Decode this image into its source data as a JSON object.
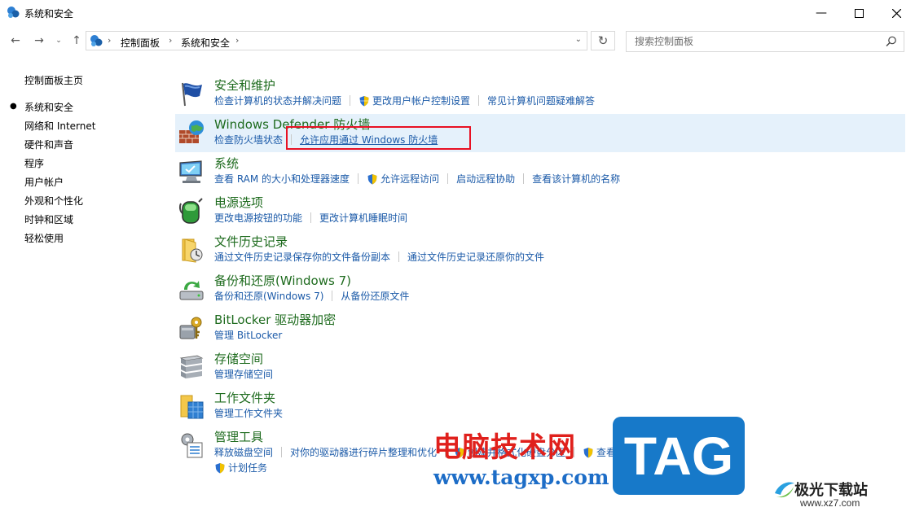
{
  "window": {
    "title": "系统和安全"
  },
  "address": {
    "crumbs": [
      "控制面板",
      "系统和安全"
    ]
  },
  "search": {
    "placeholder": "搜索控制面板"
  },
  "sidebar": {
    "home": "控制面板主页",
    "items": [
      {
        "label": "系统和安全",
        "active": true
      },
      {
        "label": "网络和 Internet"
      },
      {
        "label": "硬件和声音"
      },
      {
        "label": "程序"
      },
      {
        "label": "用户帐户"
      },
      {
        "label": "外观和个性化"
      },
      {
        "label": "时钟和区域"
      },
      {
        "label": "轻松使用"
      }
    ]
  },
  "categories": [
    {
      "title": "安全和维护",
      "icon": "flag-icon",
      "links": [
        "检查计算机的状态并解决问题",
        "更改用户帐户控制设置",
        "常见计算机问题疑难解答"
      ]
    },
    {
      "title": "Windows Defender 防火墙",
      "icon": "firewall-icon",
      "links": [
        "检查防火墙状态",
        "允许应用通过 Windows 防火墙"
      ]
    },
    {
      "title": "系统",
      "icon": "computer-icon",
      "links": [
        "查看 RAM 的大小和处理器速度",
        "允许远程访问",
        "启动远程协助",
        "查看该计算机的名称"
      ]
    },
    {
      "title": "电源选项",
      "icon": "battery-icon",
      "links": [
        "更改电源按钮的功能",
        "更改计算机睡眠时间"
      ]
    },
    {
      "title": "文件历史记录",
      "icon": "folder-clock-icon",
      "links": [
        "通过文件历史记录保存你的文件备份副本",
        "通过文件历史记录还原你的文件"
      ]
    },
    {
      "title": "备份和还原(Windows 7)",
      "icon": "backup-icon",
      "links": [
        "备份和还原(Windows 7)",
        "从备份还原文件"
      ]
    },
    {
      "title": "BitLocker 驱动器加密",
      "icon": "bitlocker-key-icon",
      "links": [
        "管理 BitLocker"
      ]
    },
    {
      "title": "存储空间",
      "icon": "storage-icon",
      "links": [
        "管理存储空间"
      ]
    },
    {
      "title": "工作文件夹",
      "icon": "work-folders-icon",
      "links": [
        "管理工作文件夹"
      ]
    },
    {
      "title": "管理工具",
      "icon": "admin-tools-icon",
      "links": [
        "释放磁盘空间",
        "对你的驱动器进行碎片整理和优化",
        "创建并格式化硬盘分区",
        "查看事件日志",
        "计划任务"
      ]
    }
  ],
  "watermark": {
    "site_cn": "电脑技术网",
    "url": "www.tagxp.com",
    "tag": "TAG",
    "brand": "极光下载站",
    "brand_url": "www.xz7.com"
  },
  "colors": {
    "link": "#1b5aa8",
    "category_title": "#1e6b1e",
    "highlight": "#e5f1fb",
    "annotation_box": "#e81123"
  }
}
